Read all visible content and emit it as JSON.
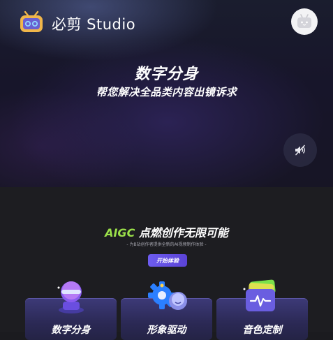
{
  "header": {
    "brand": "必剪 Studio",
    "logo_icon": "tv-logo-icon",
    "avatar_icon": "bilibili-tv-avatar-icon"
  },
  "hero": {
    "title": "数字分身",
    "subtitle": "帮您解决全品类内容出镜诉求",
    "sound_icon": "speaker-muted-icon"
  },
  "aigc": {
    "title_accent": "AIGC",
    "title_rest": " 点燃创作无限可能",
    "subtitle": "- 为B站创作者提供全新的AI视频制作体验 -",
    "button_label": "开始体验"
  },
  "cards": [
    {
      "label": "数字分身",
      "icon": "digital-avatar-icon"
    },
    {
      "label": "形象驱动",
      "icon": "gear-avatar-icon"
    },
    {
      "label": "音色定制",
      "icon": "voice-wave-icon"
    }
  ],
  "colors": {
    "accent_green": "#9be04a",
    "button_purple": "#6d5cf0",
    "card_purple": "#3d3a78",
    "page_background": "#1d1d21"
  }
}
